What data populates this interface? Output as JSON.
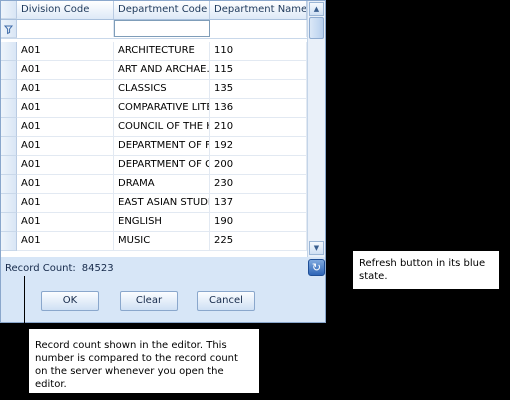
{
  "grid": {
    "columns": [
      "Division Code",
      "Department Code",
      "Department Name"
    ],
    "rows": [
      [
        "A01",
        "ARCHITECTURE",
        "110"
      ],
      [
        "A01",
        "ART AND ARCHAE...",
        "115"
      ],
      [
        "A01",
        "CLASSICS",
        "135"
      ],
      [
        "A01",
        "COMPARATIVE LITE",
        "136"
      ],
      [
        "A01",
        "COUNCIL OF THE H",
        "210"
      ],
      [
        "A01",
        "DEPARTMENT OF FR",
        "192"
      ],
      [
        "A01",
        "DEPARTMENT OF GE",
        "200"
      ],
      [
        "A01",
        "DRAMA",
        "230"
      ],
      [
        "A01",
        "EAST ASIAN STUDI",
        "137"
      ],
      [
        "A01",
        "ENGLISH",
        "190"
      ],
      [
        "A01",
        "MUSIC",
        "225"
      ]
    ]
  },
  "status": {
    "label": "Record Count:",
    "value": "84523"
  },
  "buttons": {
    "ok": "OK",
    "clear": "Clear",
    "cancel": "Cancel"
  },
  "icons": {
    "filter": "filter-icon",
    "refresh": "refresh-icon",
    "scroll_up": "chevron-up-icon",
    "scroll_down": "chevron-down-icon"
  },
  "colors": {
    "refresh_blue": "#2f66b7",
    "panel_bg": "#d7e6f7",
    "page_bg": "#000000"
  },
  "callouts": {
    "refresh": "Refresh button in its blue state.",
    "record_count": "Record count shown in the editor. This number is compared to the record count on the server whenever you open the editor."
  }
}
